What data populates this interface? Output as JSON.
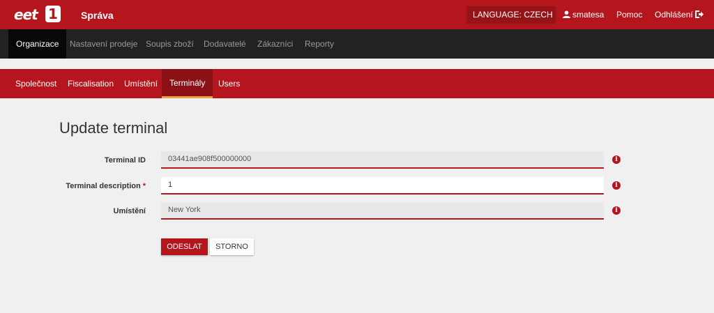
{
  "header": {
    "logo_text": "eet",
    "logo_digit": "1",
    "app_title": "Správa",
    "language_label": "LANGUAGE: CZECH",
    "username": "smatesa",
    "help_label": "Pomoc",
    "logout_label": "Odhlášení",
    "colors": {
      "brand": "#b5161d",
      "brand_dark": "#961318"
    }
  },
  "main_nav": {
    "items": [
      {
        "label": "Organizace",
        "active": true
      },
      {
        "label": "Nastavení prodeje"
      },
      {
        "label": "Soupis zboží"
      },
      {
        "label": "Dodavatelé"
      },
      {
        "label": "Zákazníci"
      },
      {
        "label": "Reporty"
      }
    ]
  },
  "sub_nav": {
    "items": [
      {
        "label": "Společnost"
      },
      {
        "label": "Fiscalisation"
      },
      {
        "label": "Umístění"
      },
      {
        "label": "Terminály",
        "active": true
      },
      {
        "label": "Users"
      }
    ]
  },
  "form": {
    "title": "Update terminal",
    "fields": [
      {
        "label": "Terminal ID",
        "value": "03441ae908f500000000",
        "required": false,
        "editable": false
      },
      {
        "label": "Terminal description",
        "value": "1",
        "required": true,
        "editable": true
      },
      {
        "label": "Umístění",
        "value": "New York",
        "required": false,
        "editable": false
      }
    ],
    "required_marker": "*",
    "info_icon": "info-circle-icon",
    "submit_label": "ODESLAT",
    "cancel_label": "STORNO"
  }
}
